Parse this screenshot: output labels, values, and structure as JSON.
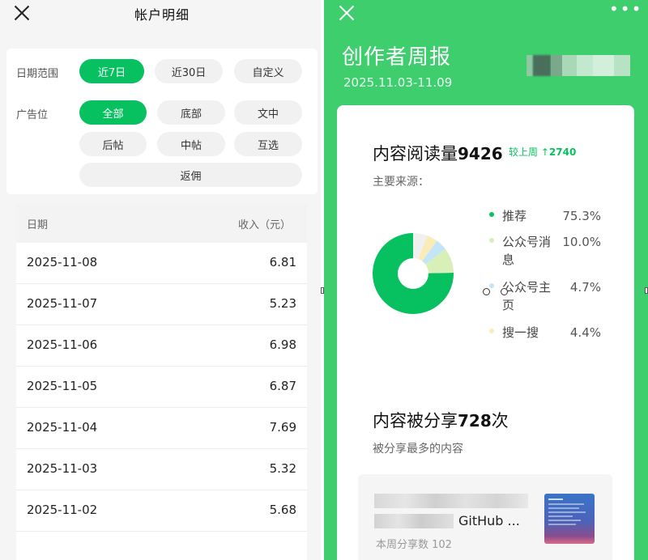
{
  "left": {
    "title": "帐户明细",
    "filters": {
      "date_label": "日期范围",
      "date_options": [
        "近7日",
        "近30日",
        "自定义"
      ],
      "date_selected": "近7日",
      "slot_label": "广告位",
      "slot_options": [
        "全部",
        "底部",
        "文中",
        "后帖",
        "中帖",
        "互选",
        "返佣"
      ],
      "slot_selected": "全部"
    },
    "table": {
      "col_date": "日期",
      "col_income": "收入（元）",
      "rows": [
        {
          "date": "2025-11-08",
          "amount": "6.81"
        },
        {
          "date": "2025-11-07",
          "amount": "5.23"
        },
        {
          "date": "2025-11-06",
          "amount": "6.98"
        },
        {
          "date": "2025-11-05",
          "amount": "6.87"
        },
        {
          "date": "2025-11-04",
          "amount": "7.69"
        },
        {
          "date": "2025-11-03",
          "amount": "5.32"
        },
        {
          "date": "2025-11-02",
          "amount": "5.68"
        }
      ]
    }
  },
  "right": {
    "headline": "创作者周报",
    "date_range": "2025.11.03-11.09",
    "more_icon": "•••",
    "reads": {
      "title_prefix": "内容阅读量",
      "count": "9426",
      "compare_label": "较上周",
      "compare_arrow": "↑",
      "compare_value": "2740",
      "sources_label": "主要来源：",
      "sources": [
        {
          "label": "推荐",
          "pct": "75.3%",
          "value": 75.3,
          "color": "#07c160"
        },
        {
          "label": "公众号消息",
          "pct": "10.0%",
          "value": 10.0,
          "color": "#d9efb8"
        },
        {
          "label": "公众号主页",
          "pct": "4.7%",
          "value": 4.7,
          "color": "#c4e4f8"
        },
        {
          "label": "搜一搜",
          "pct": "4.4%",
          "value": 4.4,
          "color": "#faecb8"
        }
      ],
      "other_color": "#f0f0f0"
    },
    "shares": {
      "title_prefix": "内容被分享",
      "count": "728",
      "title_suffix": "次",
      "most_shared_label": "被分享最多的内容",
      "article_title_visible": "GitHub ...",
      "article_shares": "本周分享数 102"
    }
  }
}
